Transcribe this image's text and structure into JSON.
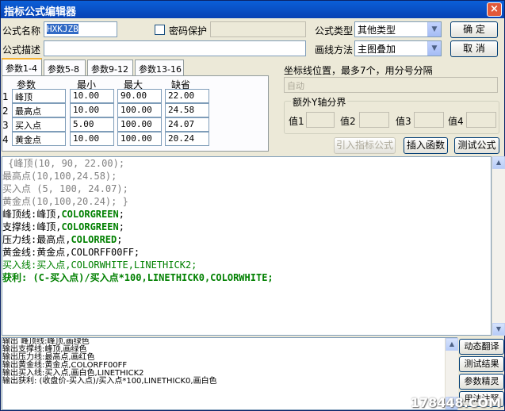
{
  "title": "指标公式编辑器",
  "close_glyph": "×",
  "form": {
    "name_label": "公式名称",
    "name_value": "HXKJZB",
    "password_label": "密码保护",
    "desc_label": "公式描述",
    "desc_value": "",
    "type_label": "公式类型",
    "type_value": "其他类型",
    "draw_label": "画线方法",
    "draw_value": "主图叠加"
  },
  "buttons": {
    "ok": "确  定",
    "cancel": "取  消",
    "import": "引入指标公式",
    "insert": "插入函数",
    "test": "测试公式"
  },
  "tabs": [
    "参数1-4",
    "参数5-8",
    "参数9-12",
    "参数13-16"
  ],
  "params": {
    "headers": [
      "参数",
      "最小",
      "最大",
      "缺省"
    ],
    "rows": [
      {
        "idx": "1",
        "name": "峰顶",
        "min": "10.00",
        "max": "90.00",
        "def": "22.00"
      },
      {
        "idx": "2",
        "name": "最高点",
        "min": "10.00",
        "max": "100.00",
        "def": "24.58"
      },
      {
        "idx": "3",
        "name": "买入点",
        "min": "5.00",
        "max": "100.00",
        "def": "24.07"
      },
      {
        "idx": "4",
        "name": "黄金点",
        "min": "10.00",
        "max": "100.00",
        "def": "20.24"
      }
    ]
  },
  "coords": {
    "label": "坐标线位置，最多7个，用分号分隔",
    "placeholder": "自动"
  },
  "yaxis": {
    "title": "额外Y轴分界",
    "labels": [
      "值1",
      "值2",
      "值3",
      "值4"
    ]
  },
  "code": [
    {
      "text": " {峰顶(10, 90, 22.00);",
      "color": "#808080",
      "bold": false
    },
    {
      "text": "最高点(10,100,24.58);",
      "color": "#808080",
      "bold": false
    },
    {
      "text": "买入点 (5, 100, 24.07);",
      "color": "#808080",
      "bold": false
    },
    {
      "text": "黄金点(10,100,20.24); }",
      "color": "#808080",
      "bold": false
    },
    {
      "text": "峰顶线:峰顶,COLORGREEN;",
      "color": "#000000",
      "bold": false,
      "kw": "COLORGREEN",
      "kwcolor": "#008000"
    },
    {
      "text": "支撑线:峰顶,COLORGREEN;",
      "color": "#000000",
      "bold": false,
      "kw": "COLORGREEN",
      "kwcolor": "#008000"
    },
    {
      "text": "压力线:最高点,COLORRED;",
      "color": "#000000",
      "bold": false,
      "kw": "COLORRED",
      "kwcolor": "#008000"
    },
    {
      "text": "黄金线:黄金点,COLORFF00FF;",
      "color": "#000000",
      "bold": false
    },
    {
      "text": "买入线:买入点,COLORWHITE,LINETHICK2;",
      "color": "#008000",
      "bold": false
    },
    {
      "text": "获利: (C-买入点)/买入点*100,LINETHICK0,COLORWHITE;",
      "color": "#008000",
      "bold": true
    }
  ],
  "output": [
    "输出 峰顶线:峰顶,画绿色",
    "输出支撑线:峰顶,画绿色",
    "输出压力线:最高点,画红色",
    "输出黄金线:黄金点,COLORFF00FF",
    "输出买入线:买入点,画白色,LINETHICK2",
    "输出获利: (收盘价-买入点)/买入点*100,LINETHICK0,画白色"
  ],
  "side_buttons": [
    "动态翻译",
    "测试结果",
    "参数精灵",
    "用法注释"
  ],
  "watermark": "178448.COM"
}
